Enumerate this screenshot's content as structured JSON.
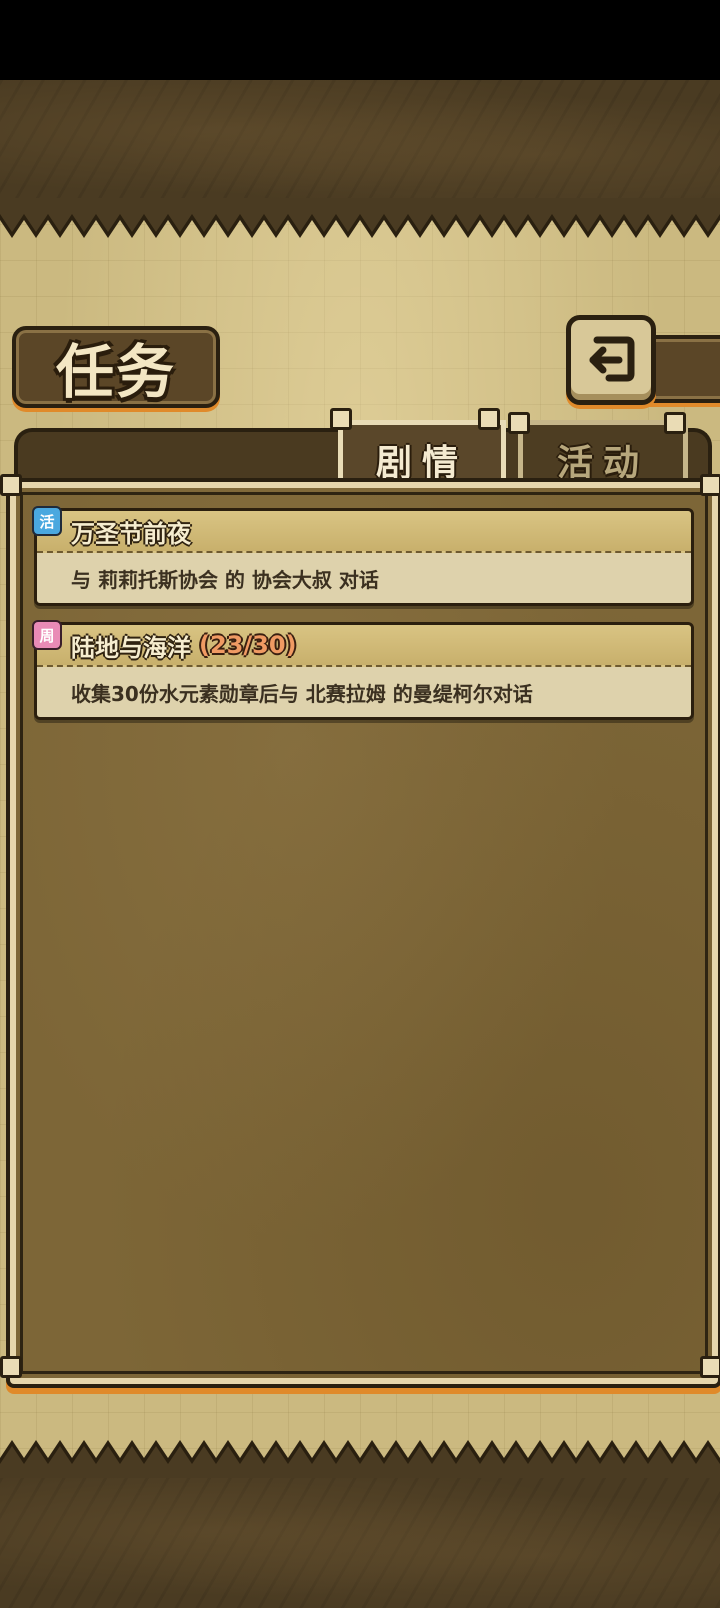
{
  "screen": {
    "title": "任务",
    "back_icon": "back-arrow-icon"
  },
  "tabs": [
    {
      "label": "剧情",
      "selected": true
    },
    {
      "label": "活动",
      "selected": false
    }
  ],
  "quests": [
    {
      "badge": "活",
      "badge_color": "#4aa8df",
      "title": "万圣节前夜",
      "progress": "",
      "description": "与 莉莉托斯协会 的 协会大叔 对话"
    },
    {
      "badge": "周",
      "badge_color": "#e98bb6",
      "title": "陆地与海洋",
      "progress": "(23/30)",
      "description": "收集30份水元素勋章后与 北赛拉姆 的曼缇柯尔对话"
    }
  ],
  "colors": {
    "parchment": "#cbb980",
    "panel": "#7d6637",
    "accent_orange": "#e08a2a",
    "progress_text": "#f09a63"
  }
}
